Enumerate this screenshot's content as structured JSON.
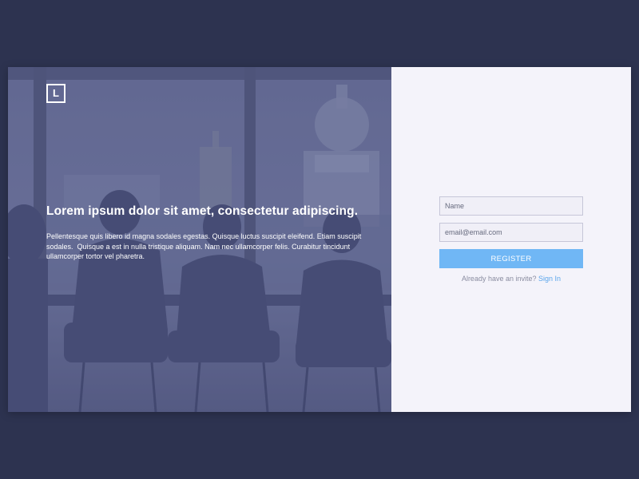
{
  "hero": {
    "logo_letter": "L",
    "headline": "Lorem ipsum dolor sit amet, consectetur adipiscing.",
    "body": "Pellentesque quis libero id magna sodales egestas. Quisque luctus suscipit eleifend. Etiam suscipit sodales.  Quisque a est in nulla tristique aliquam. Nam nec ullamcorper felis. Curabitur tincidunt ullamcorper tortor vel pharetra."
  },
  "form": {
    "name_placeholder": "Name",
    "email_placeholder": "email@email.com",
    "register_label": "REGISTER",
    "invite_text": "Already have an invite?",
    "signin_label": "Sign In"
  },
  "colors": {
    "background": "#2d3350",
    "hero_overlay": "#5b6188",
    "panel": "#f4f3fa",
    "accent": "#70b7f5",
    "link": "#5ca6ec"
  },
  "icons": {
    "logo": "letter-l-logo-icon"
  }
}
